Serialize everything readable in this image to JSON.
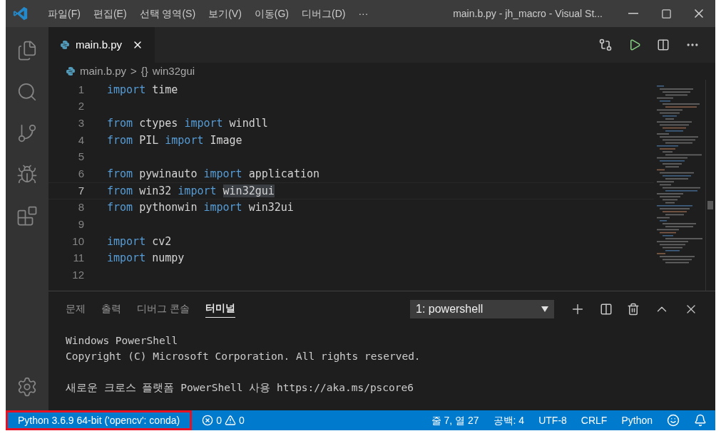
{
  "window": {
    "title": "main.b.py - jh_macro - Visual St..."
  },
  "menu": [
    "파일(F)",
    "편집(E)",
    "선택 영역(S)",
    "보기(V)",
    "이동(G)",
    "디버그(D)",
    "···"
  ],
  "tabs": [
    {
      "label": "main.b.py",
      "selected": true
    }
  ],
  "breadcrumb": {
    "file": "main.b.py",
    "separator": ">",
    "symbol_glyph": "{}",
    "symbol": "win32gui"
  },
  "lines": [
    {
      "number": "1",
      "current": false,
      "tokens": [
        {
          "kind": "keyword",
          "text": "import"
        },
        {
          "kind": "plain",
          "text": " time"
        }
      ]
    },
    {
      "number": "2",
      "current": false
    },
    {
      "number": "3",
      "current": false,
      "tokens": [
        {
          "kind": "keyword",
          "text": "from"
        },
        {
          "kind": "plain",
          "text": " ctypes "
        },
        {
          "kind": "keyword",
          "text": "import"
        },
        {
          "kind": "plain",
          "text": " windll"
        }
      ]
    },
    {
      "number": "4",
      "current": false,
      "tokens": [
        {
          "kind": "keyword",
          "text": "from"
        },
        {
          "kind": "plain",
          "text": " PIL "
        },
        {
          "kind": "keyword",
          "text": "import"
        },
        {
          "kind": "plain",
          "text": " Image"
        }
      ]
    },
    {
      "number": "5",
      "current": false
    },
    {
      "number": "6",
      "current": false,
      "tokens": [
        {
          "kind": "keyword",
          "text": "from"
        },
        {
          "kind": "plain",
          "text": " pywinauto "
        },
        {
          "kind": "keyword",
          "text": "import"
        },
        {
          "kind": "plain",
          "text": " application"
        }
      ]
    },
    {
      "number": "7",
      "current": true,
      "tokens": [
        {
          "kind": "keyword",
          "text": "from"
        },
        {
          "kind": "plain",
          "text": " win32 "
        },
        {
          "kind": "keyword",
          "text": "import "
        },
        {
          "kind": "match",
          "text": "win32gui"
        }
      ]
    },
    {
      "number": "8",
      "current": false,
      "tokens": [
        {
          "kind": "keyword",
          "text": "from"
        },
        {
          "kind": "plain",
          "text": " pythonwin "
        },
        {
          "kind": "keyword",
          "text": "import"
        },
        {
          "kind": "plain",
          "text": " win32ui"
        }
      ]
    },
    {
      "number": "9",
      "current": false
    },
    {
      "number": "10",
      "current": false,
      "tokens": [
        {
          "kind": "keyword",
          "text": "import"
        },
        {
          "kind": "plain",
          "text": " cv2"
        }
      ]
    },
    {
      "number": "11",
      "current": false,
      "tokens": [
        {
          "kind": "keyword",
          "text": "import"
        },
        {
          "kind": "plain",
          "text": " numpy"
        }
      ]
    },
    {
      "number": "12",
      "current": false
    }
  ],
  "panel": {
    "tabs": [
      {
        "label": "문제",
        "selected": false
      },
      {
        "label": "출력",
        "selected": false
      },
      {
        "label": "디버그 콘솔",
        "selected": false
      },
      {
        "label": "터미널",
        "selected": true
      }
    ],
    "terminal_select": "1: powershell",
    "terminal_paragraphs": [
      [
        "Windows PowerShell",
        "Copyright (C) Microsoft Corporation. All rights reserved."
      ],
      [
        "새로운 크로스 플랫폼 PowerShell 사용 https://aka.ms/pscore6"
      ]
    ]
  },
  "status_bar": {
    "interpreter": {
      "text": "Python 3.6.9 64-bit ('opencv': conda)",
      "highlighted": true
    },
    "errors": "0",
    "warnings": "0",
    "right": [
      "줄 7, 열 27",
      "공백: 4",
      "UTF-8",
      "CRLF",
      "Python"
    ]
  }
}
